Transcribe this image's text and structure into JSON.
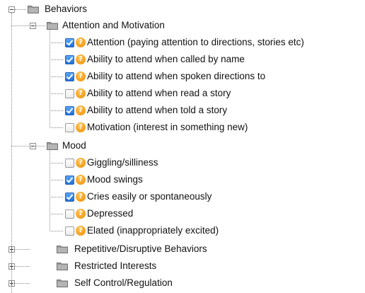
{
  "tree": {
    "root": {
      "label": "Behaviors",
      "expanded": true,
      "groups": [
        {
          "label": "Attention and Motivation",
          "expanded": true,
          "items": [
            {
              "label": "Attention (paying attention to directions, stories etc)",
              "checked": true
            },
            {
              "label": "Ability to attend when called by name",
              "checked": true
            },
            {
              "label": "Ability to attend when spoken directions to",
              "checked": true
            },
            {
              "label": "Ability to attend when read a story",
              "checked": false
            },
            {
              "label": "Ability to attend when told a story",
              "checked": true
            },
            {
              "label": "Motivation (interest in something new)",
              "checked": false
            }
          ]
        },
        {
          "label": "Mood",
          "expanded": true,
          "items": [
            {
              "label": "Giggling/silliness",
              "checked": false
            },
            {
              "label": "Mood swings",
              "checked": true
            },
            {
              "label": "Cries easily or spontaneously",
              "checked": true
            },
            {
              "label": "Depressed",
              "checked": false
            },
            {
              "label": "Elated (inappropriately excited)",
              "checked": false
            }
          ]
        },
        {
          "label": "Repetitive/Disruptive Behaviors",
          "expanded": false,
          "items": []
        },
        {
          "label": "Restricted Interests",
          "expanded": false,
          "items": []
        },
        {
          "label": "Self Control/Regulation",
          "expanded": false,
          "items": []
        }
      ]
    },
    "help_glyph": "?",
    "icons": {
      "folder": "folder-icon",
      "help": "help-icon",
      "expand": "expand-toggle-icon"
    },
    "colors": {
      "help": "#f08a00",
      "checkbox_checked": "#1f6fd6",
      "folder": "#9a9a9a"
    }
  }
}
